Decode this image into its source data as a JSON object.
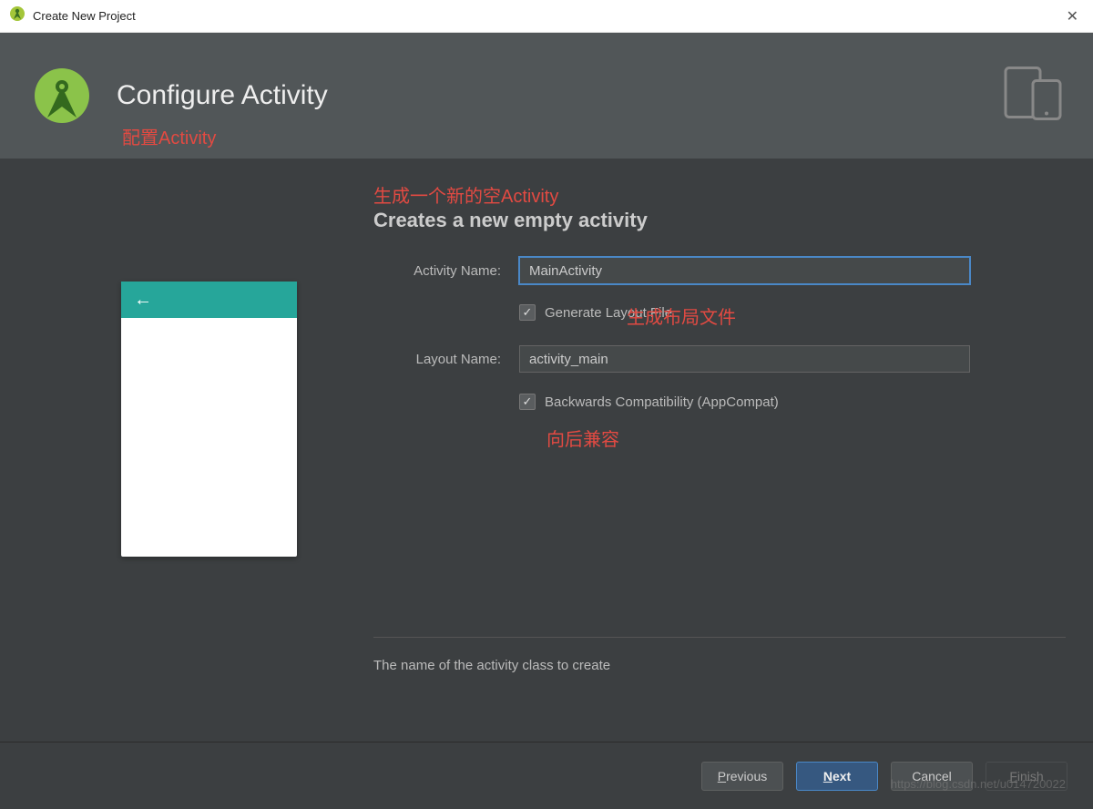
{
  "titlebar": {
    "title": "Create New Project"
  },
  "header": {
    "title": "Configure Activity",
    "subtitle_cn": "配置Activity"
  },
  "main": {
    "annotation_top_cn": "生成一个新的空Activity",
    "section_title": "Creates a new empty activity",
    "activity_name_label": "Activity Name:",
    "activity_name_value": "MainActivity",
    "generate_layout_label": "Generate Layout File",
    "generate_layout_annotation_cn": "生成布局文件",
    "layout_name_label": "Layout Name:",
    "layout_name_value": "activity_main",
    "backwards_compat_label": "Backwards Compatibility (AppCompat)",
    "backwards_compat_annotation_cn": "向后兼容",
    "hint_text": "The name of the activity class to create"
  },
  "footer": {
    "previous": "Previous",
    "next": "Next",
    "cancel": "Cancel",
    "finish": "Finish"
  },
  "watermark": "https://blog.csdn.net/u014720022"
}
